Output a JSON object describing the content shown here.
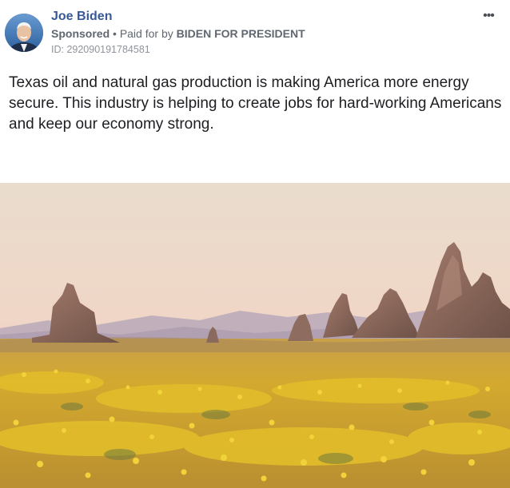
{
  "post": {
    "page_name": "Joe Biden",
    "sponsored_label": "Sponsored",
    "separator": "•",
    "paid_for_prefix": "Paid for by",
    "payer": "BIDEN FOR PRESIDENT",
    "ad_id": "ID: 292090191784581",
    "more_icon": "more-options-icon",
    "more_glyph": "•••",
    "body_text": "Texas oil and natural gas production is making America more energy secure. This industry is helping to create jobs for hard-working Americans and keep our economy strong."
  },
  "colors": {
    "page_name": "#385898",
    "meta_text": "#606770",
    "body_text": "#1c1e21"
  }
}
